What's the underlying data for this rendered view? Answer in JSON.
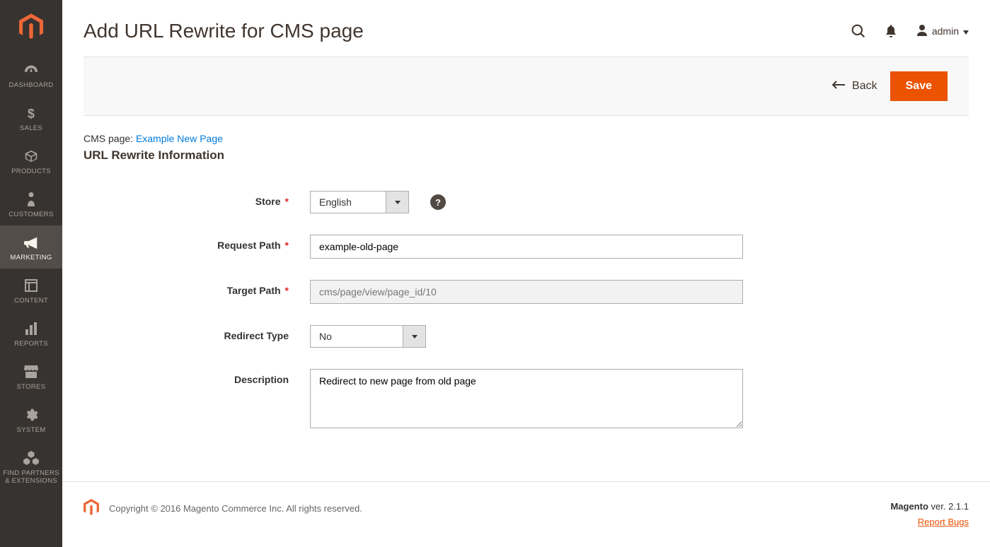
{
  "sidebar": {
    "items": [
      {
        "label": "DASHBOARD",
        "icon": "gauge"
      },
      {
        "label": "SALES",
        "icon": "dollar"
      },
      {
        "label": "PRODUCTS",
        "icon": "box"
      },
      {
        "label": "CUSTOMERS",
        "icon": "person"
      },
      {
        "label": "MARKETING",
        "icon": "megaphone"
      },
      {
        "label": "CONTENT",
        "icon": "layout"
      },
      {
        "label": "REPORTS",
        "icon": "bars"
      },
      {
        "label": "STORES",
        "icon": "storefront"
      },
      {
        "label": "SYSTEM",
        "icon": "gear"
      },
      {
        "label": "FIND PARTNERS\n& EXTENSIONS",
        "icon": "cubes"
      }
    ],
    "active_index": 4
  },
  "header": {
    "page_title": "Add URL Rewrite for CMS page",
    "admin_label": "admin"
  },
  "actionbar": {
    "back_label": "Back",
    "save_label": "Save"
  },
  "breadcrumb": {
    "prefix": "CMS page: ",
    "link_text": "Example New Page"
  },
  "section_title": "URL Rewrite Information",
  "form": {
    "store": {
      "label": "Store",
      "value": "English"
    },
    "request_path": {
      "label": "Request Path",
      "value": "example-old-page"
    },
    "target_path": {
      "label": "Target Path",
      "value": "cms/page/view/page_id/10"
    },
    "redirect_type": {
      "label": "Redirect Type",
      "value": "No"
    },
    "description": {
      "label": "Description",
      "value": "Redirect to new page from old page"
    }
  },
  "footer": {
    "copyright": "Copyright © 2016 Magento Commerce Inc. All rights reserved.",
    "product": "Magento",
    "version_prefix": " ver. ",
    "version": "2.1.1",
    "report_bugs": "Report Bugs"
  },
  "help_tooltip": "?"
}
